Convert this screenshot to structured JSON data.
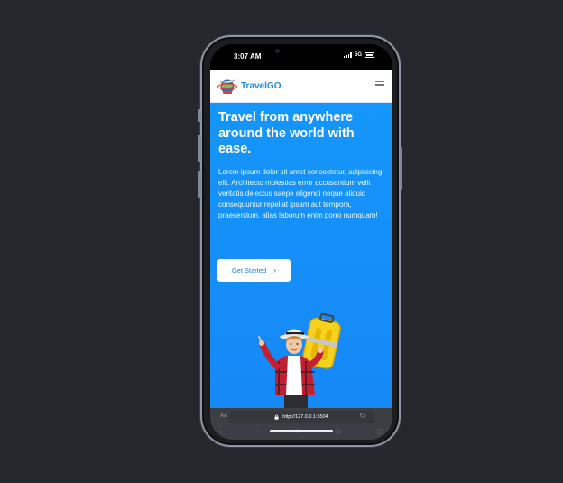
{
  "status_bar": {
    "time": "3:07 AM",
    "network": "5G"
  },
  "navbar": {
    "brand": "TravelGO",
    "logo_icon": "globe-plane-logo-icon",
    "menu_icon": "hamburger-menu-icon"
  },
  "hero": {
    "title": "Travel from anywhere around the world with ease.",
    "text": "Lorem ipsum dolor sit amet consectetur, adipisicing elit. Architecto molestias error accusantium velit veritatis delectus saepe eligendi neque aliquid consequuntur repellat ipsam aut tempora, praesentium, alias laborum enim porro numquam!",
    "cta_label": "Get Started",
    "cta_icon": "chevron-right-icon",
    "illustration": "child-with-yellow-suitcase",
    "background": "#1596fa"
  },
  "browser": {
    "text_size_label": "AA",
    "url": "http://127.0.0.1:5504"
  }
}
